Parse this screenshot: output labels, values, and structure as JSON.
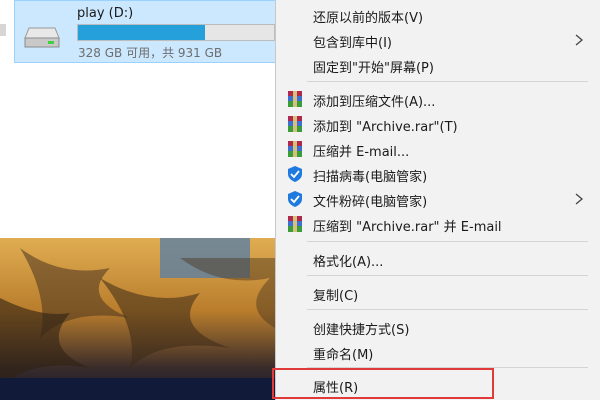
{
  "explorer": {
    "drive": {
      "name": "play (D:)",
      "free_text": "328 GB 可用，共 931 GB",
      "used_fraction": 0.648,
      "bar_color": "#26a0da",
      "icon": "hard-drive-icon"
    }
  },
  "menu": {
    "items": {
      "restore": "还原以前的版本(V)",
      "include": "包含到库中(I)",
      "pin_start": "固定到\"开始\"屏幕(P)",
      "add_archive": "添加到压缩文件(A)...",
      "add_rar": "添加到 \"Archive.rar\"(T)",
      "compress_email": "压缩并 E-mail...",
      "scan_virus": "扫描病毒(电脑管家)",
      "shred": "文件粉碎(电脑管家)",
      "compress_rar_email": "压缩到 \"Archive.rar\" 并 E-mail",
      "format": "格式化(A)...",
      "copy": "复制(C)",
      "shortcut": "创建快捷方式(S)",
      "rename": "重命名(M)",
      "properties": "属性(R)"
    },
    "icons": {
      "winrar": "winrar-icon",
      "tencent": "tencent-shield-icon"
    },
    "highlight_color": "#e03a3a"
  }
}
